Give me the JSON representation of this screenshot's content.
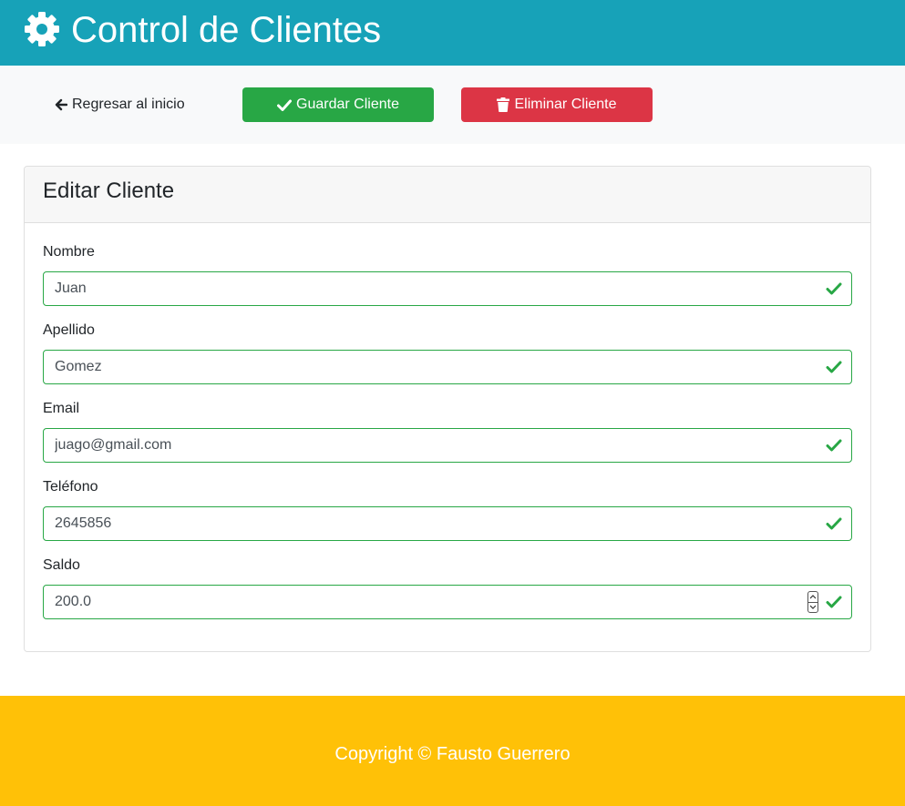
{
  "header": {
    "title": "Control de Clientes",
    "icon": "gear-icon",
    "background": "#17a2b8"
  },
  "toolbar": {
    "back_label": "Regresar al inicio",
    "back_icon": "arrow-left-icon",
    "save_label": "Guardar Cliente",
    "save_icon": "check-icon",
    "save_color": "#28a745",
    "delete_label": "Eliminar Cliente",
    "delete_icon": "trash-icon",
    "delete_color": "#dc3545"
  },
  "card": {
    "title": "Editar Cliente",
    "fields": {
      "nombre": {
        "label": "Nombre",
        "value": "Juan"
      },
      "apellido": {
        "label": "Apellido",
        "value": "Gomez"
      },
      "email": {
        "label": "Email",
        "value": "juago@gmail.com"
      },
      "telefono": {
        "label": "Teléfono",
        "value": "2645856"
      },
      "saldo": {
        "label": "Saldo",
        "value": "200.0"
      }
    },
    "valid_color": "#28a745"
  },
  "footer": {
    "text": "Copyright © Fausto Guerrero",
    "background": "#ffc107"
  }
}
